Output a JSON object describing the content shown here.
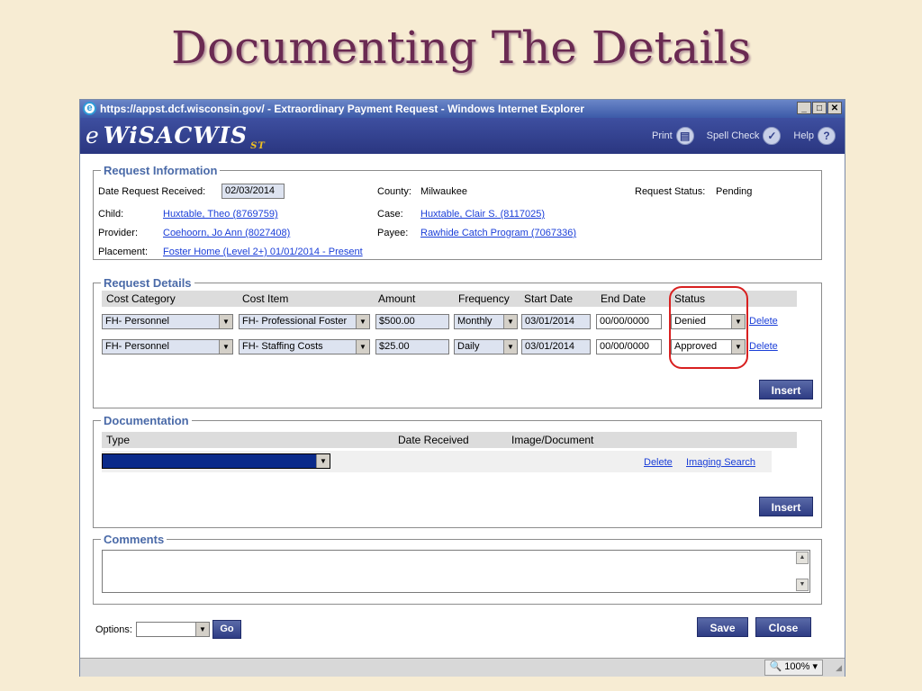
{
  "slide": {
    "title": "Documenting The Details"
  },
  "browser": {
    "title": "https://appst.dcf.wisconsin.gov/ - Extraordinary Payment Request - Windows Internet Explorer",
    "zoom": "100%"
  },
  "app": {
    "brand_e": "e",
    "brand_name": "WiSACWIS",
    "brand_suffix": "ST",
    "print_label": "Print",
    "spellcheck_label": "Spell Check",
    "help_label": "Help"
  },
  "request_info": {
    "legend": "Request Information",
    "date_received_label": "Date Request Received:",
    "date_received_value": "02/03/2014",
    "county_label": "County:",
    "county_value": "Milwaukee",
    "status_label": "Request Status:",
    "status_value": "Pending",
    "child_label": "Child:",
    "child_value": "Huxtable, Theo (8769759)",
    "case_label": "Case:",
    "case_value": "Huxtable, Clair S. (8117025)",
    "provider_label": "Provider:",
    "provider_value": "Coehoorn, Jo Ann (8027408)",
    "payee_label": "Payee:",
    "payee_value": "Rawhide Catch Program (7067336)",
    "placement_label": "Placement:",
    "placement_value": "Foster Home (Level 2+) 01/01/2014 - Present"
  },
  "request_details": {
    "legend": "Request Details",
    "headers": {
      "cost_category": "Cost Category",
      "cost_item": "Cost Item",
      "amount": "Amount",
      "frequency": "Frequency",
      "start_date": "Start Date",
      "end_date": "End Date",
      "status": "Status"
    },
    "rows": [
      {
        "cost_category": "FH- Personnel",
        "cost_item": "FH- Professional Foster",
        "amount": "$500.00",
        "frequency": "Monthly",
        "start_date": "03/01/2014",
        "end_date": "00/00/0000",
        "status": "Denied",
        "delete": "Delete"
      },
      {
        "cost_category": "FH- Personnel",
        "cost_item": "FH- Staffing Costs",
        "amount": "$25.00",
        "frequency": "Daily",
        "start_date": "03/01/2014",
        "end_date": "00/00/0000",
        "status": "Approved",
        "delete": "Delete"
      }
    ],
    "insert_label": "Insert"
  },
  "documentation": {
    "legend": "Documentation",
    "headers": {
      "type": "Type",
      "date_received": "Date Received",
      "image_document": "Image/Document"
    },
    "row": {
      "delete": "Delete",
      "imaging_search": "Imaging Search"
    },
    "insert_label": "Insert"
  },
  "comments": {
    "legend": "Comments"
  },
  "footer": {
    "options_label": "Options:",
    "go_label": "Go",
    "save_label": "Save",
    "close_label": "Close"
  }
}
